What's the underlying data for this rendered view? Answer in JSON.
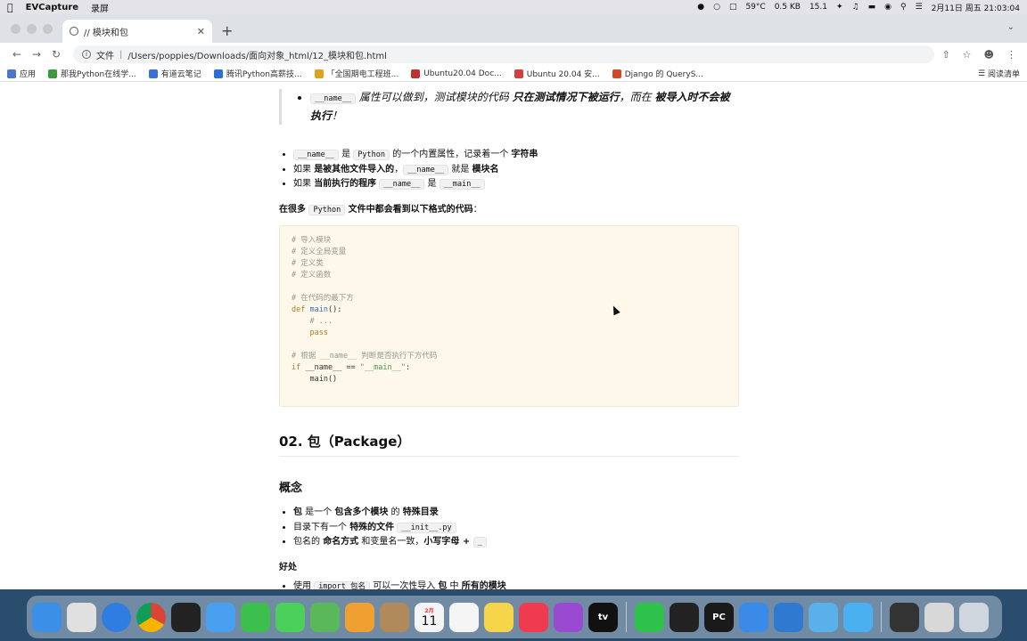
{
  "menubar": {
    "app_name": "EVCapture",
    "menu_item": "录屏",
    "cpu_temp": "59°C",
    "net_speed": "0.5 KB",
    "cpu_usage": "15.1",
    "datetime": "2月11日 周五 21:03:04"
  },
  "browser": {
    "tab_title": "// 模块和包",
    "address_prefix": "文件",
    "address_path": "/Users/poppies/Downloads/面向对象_html/12_模块和包.html",
    "bookmarks": [
      {
        "label": "应用",
        "color": "#4a78c8"
      },
      {
        "label": "那我Python在线学...",
        "color": "#3c9a3c"
      },
      {
        "label": "有道云笔记",
        "color": "#3a6fd8"
      },
      {
        "label": "腾讯Python高薪技...",
        "color": "#2f6fd0"
      },
      {
        "label": "「全国期电工程班...",
        "color": "#e0a020"
      },
      {
        "label": "Ubuntu20.04 Doc...",
        "color": "#c03030"
      },
      {
        "label": "Ubuntu 20.04 安...",
        "color": "#d04040"
      },
      {
        "label": "Django 的 QueryS...",
        "color": "#d04a2a"
      }
    ],
    "reading_list": "阅读清单"
  },
  "article": {
    "quote": {
      "code": "__name__",
      "text1": " 属性可以做到，测试模块的代码 ",
      "bold1": "只在测试情况下被运行",
      "text2": "，而在 ",
      "bold2": "被导入时不会被执行",
      "text3": "！"
    },
    "list1": {
      "item1": {
        "code1": "__name__",
        "t1": " 是 ",
        "code2": "Python",
        "t2": " 的一个内置属性，记录着一个 ",
        "b1": "字符串"
      },
      "item2": {
        "t1": "如果 ",
        "b1": "是被其他文件导入的",
        "t2": "，",
        "code1": "__name__",
        "t3": " 就是 ",
        "b2": "模块名"
      },
      "item3": {
        "t1": "如果 ",
        "b1": "当前执行的程序",
        "code1": "__name__",
        "t2": " 是 ",
        "code2": "__main__"
      }
    },
    "para1": {
      "b1": "在很多 ",
      "code1": "Python",
      "b2": " 文件中都会看到以下格式的代码",
      "t1": "："
    },
    "code_lines": {
      "l1": "# 导入模块",
      "l2": "# 定义全局变量",
      "l3": "# 定义类",
      "l4": "# 定义函数",
      "l6": "# 在代码的最下方",
      "l7_kw": "def",
      "l7_fn": "main",
      "l7_rest": "():",
      "l8": "    # ...",
      "l9": "    pass",
      "l11": "# 根据 __name__ 判断是否执行下方代码",
      "l12_kw": "if",
      "l12_mid": " __name__ == ",
      "l12_st": "\"__main__\"",
      "l12_end": ":",
      "l13": "    main()"
    },
    "h2": "02. 包（Package）",
    "h3": "概念",
    "list2": {
      "item1": {
        "b1": "包",
        "t1": " 是一个 ",
        "b2": "包含多个模块",
        "t2": " 的 ",
        "b3": "特殊目录"
      },
      "item2": {
        "t1": "目录下有一个 ",
        "b1": "特殊的文件",
        "code1": "__init__.py"
      },
      "item3": {
        "t1": "包名的 ",
        "b1": "命名方式",
        "t2": " 和变量名一致，",
        "b2": "小写字母 + ",
        "code1": "_"
      }
    },
    "para2": "好处",
    "list3": {
      "item1": {
        "t1": "使用 ",
        "code1": "import 包名",
        "t2": " 可以一次性导入 ",
        "b1": "包",
        "t3": " 中 ",
        "b2": "所有的模块"
      }
    }
  },
  "dock": [
    {
      "name": "finder-icon",
      "color": "#3b8fe6"
    },
    {
      "name": "launchpad-icon",
      "color": "#e0e0e0"
    },
    {
      "name": "safari-icon",
      "color": "#2f7de0"
    },
    {
      "name": "chrome-icon",
      "color": "#e8e8e8"
    },
    {
      "name": "terminal-icon",
      "color": "#222222"
    },
    {
      "name": "mail-icon",
      "color": "#4aa0f0"
    },
    {
      "name": "facetime-icon",
      "color": "#3cbf4c"
    },
    {
      "name": "messages-icon",
      "color": "#4cd05c"
    },
    {
      "name": "maps-icon",
      "color": "#5ab85a"
    },
    {
      "name": "photos-icon",
      "color": "#f0a030"
    },
    {
      "name": "contacts-icon",
      "color": "#b08a5a"
    },
    {
      "name": "calendar-icon",
      "color": "#f5f5f5"
    },
    {
      "name": "reminders-icon",
      "color": "#f5f5f5"
    },
    {
      "name": "notes-icon",
      "color": "#f7d54a"
    },
    {
      "name": "music-icon",
      "color": "#f03a50"
    },
    {
      "name": "podcasts-icon",
      "color": "#9a4ad0"
    },
    {
      "name": "tv-icon",
      "color": "#111111"
    },
    {
      "name": "wechat-icon",
      "color": "#2fc24a"
    },
    {
      "name": "qq-icon",
      "color": "#222222"
    },
    {
      "name": "pycharm-icon",
      "color": "#1a1a1a"
    },
    {
      "name": "baidunetdisk-icon",
      "color": "#3a8ae8"
    },
    {
      "name": "vscode-icon",
      "color": "#2f7ad0"
    },
    {
      "name": "evcapture-icon",
      "color": "#5ab0e8"
    },
    {
      "name": "qqchat-icon",
      "color": "#4ab0f0"
    },
    {
      "name": "screen-thumbnail-icon",
      "color": "#333333"
    },
    {
      "name": "preview-thumbnail-icon",
      "color": "#d8d8d8"
    },
    {
      "name": "trash-icon",
      "color": "#cfd6de"
    }
  ],
  "calendar_day": "11",
  "calendar_month": "2月",
  "tv_label": "tv",
  "pycharm_label": "PC"
}
